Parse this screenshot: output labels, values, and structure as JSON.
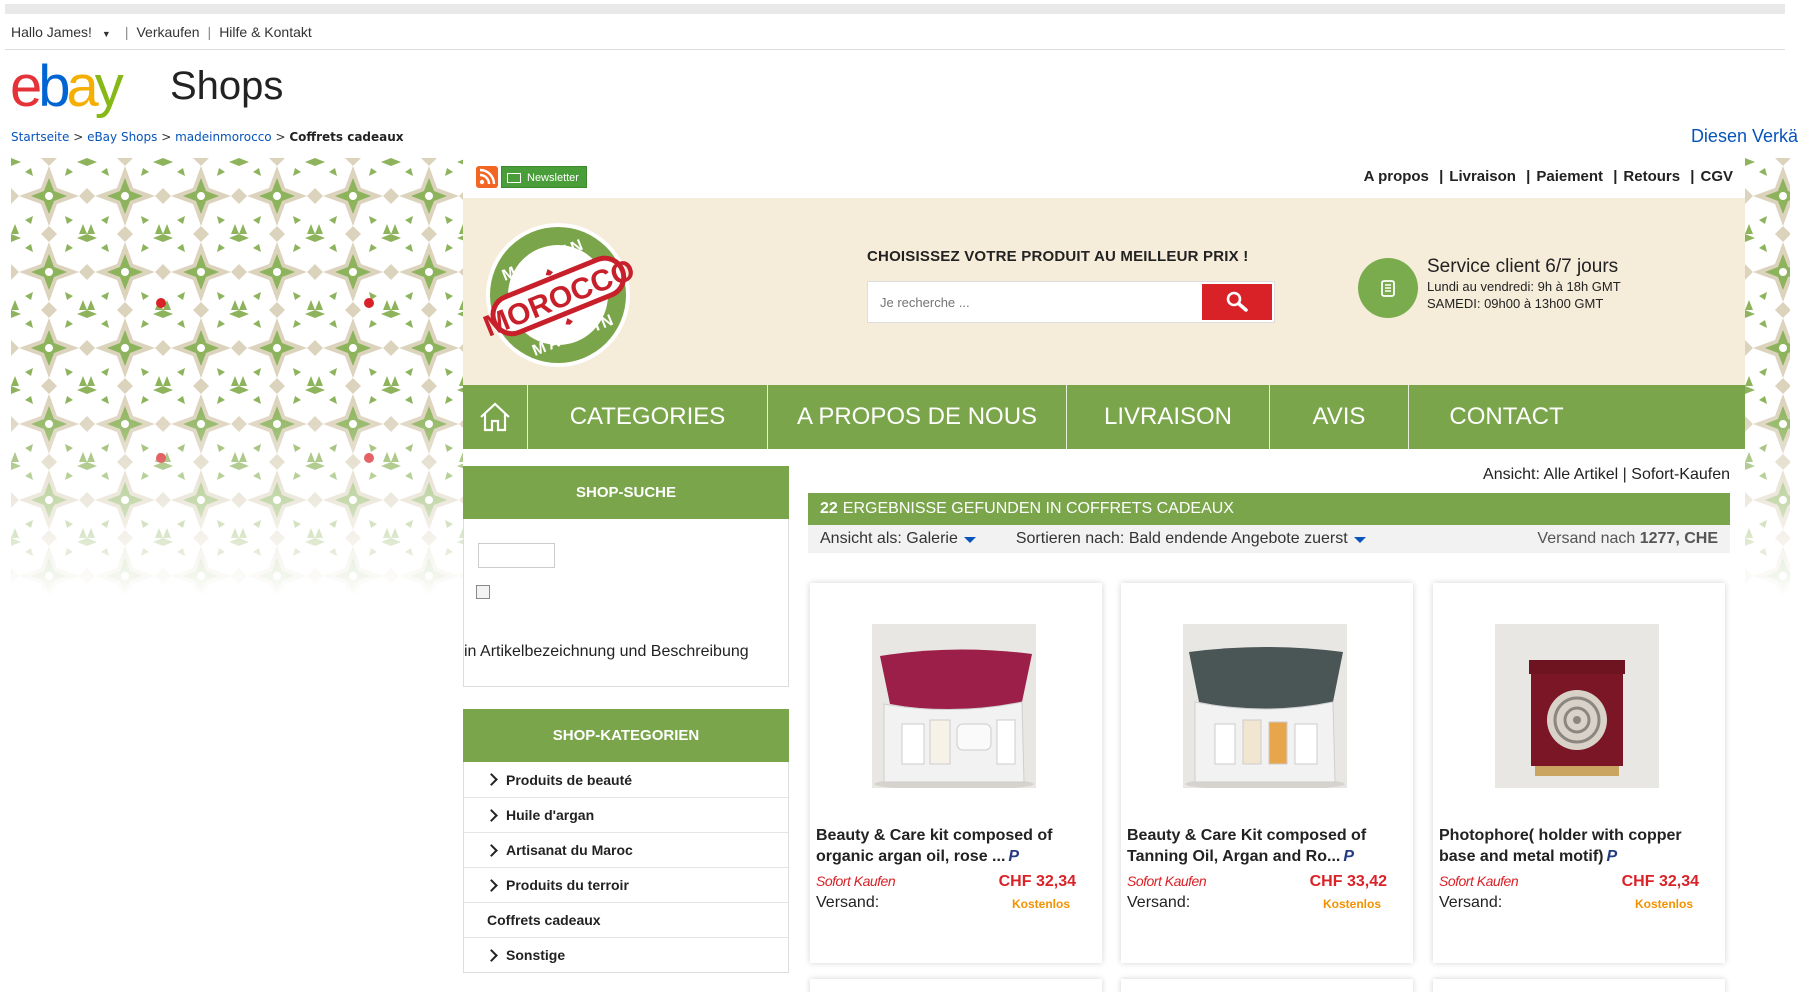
{
  "topbar": {
    "greeting": "Hallo James!",
    "sell": "Verkaufen",
    "help": "Hilfe & Kontakt"
  },
  "brand": {
    "logo_e": "e",
    "logo_b": "b",
    "logo_a": "a",
    "logo_y": "y",
    "section": "Shops",
    "colors": {
      "red": "#e53238",
      "blue": "#0064d2",
      "yellow": "#f5af02",
      "green": "#86b817"
    }
  },
  "breadcrumb": {
    "items": [
      "Startseite",
      "eBay Shops",
      "madeinmorocco"
    ],
    "current": "Coffrets cadeaux",
    "seller_link": "Diesen Verkä"
  },
  "store": {
    "newsletter": "Newsletter",
    "util_links": [
      "A propos",
      "Livraison",
      "Paiement",
      "Retours",
      "CGV"
    ],
    "logo_text_top": "MADE IN",
    "logo_text_main": "MOROCCO",
    "logo_text_bottom": "MADE IN",
    "tagline": "CHOISISSEZ VOTRE PRODUIT AU MEILLEUR PRIX !",
    "search_placeholder": "Je recherche ...",
    "service_title": "Service client 6/7 jours",
    "service_line1": "Lundi au vendredi: 9h à 18h GMT",
    "service_line2": "SAMEDI: 09h00 à 13h00 GMT",
    "accent": "#7aa54a",
    "header_bg": "#f6ecda"
  },
  "nav": {
    "items": [
      "CATEGORIES",
      "A PROPOS DE NOUS",
      "LIVRAISON",
      "AVIS",
      "CONTACT"
    ]
  },
  "sidebar": {
    "search_title": "SHOP-SUCHE",
    "search_scope_label": "in Artikelbezeichnung und Beschreibung",
    "categories_title": "SHOP-KATEGORIEN",
    "categories": [
      "Produits de beauté",
      "Huile d'argan",
      "Artisanat du Maroc",
      "Produits du terroir",
      "Coffrets cadeaux",
      "Sonstige"
    ]
  },
  "results": {
    "view_label": "Ansicht:",
    "view_all": "Alle Artikel",
    "view_buy_now": "Sofort-Kaufen",
    "count": "22",
    "found_text": "ERGEBNISSE GEFUNDEN IN COFFRETS CADEAUX",
    "view_as_label": "Ansicht als:",
    "view_as_value": "Galerie",
    "sort_label": "Sortieren nach:",
    "sort_value": "Bald endende Angebote zuerst",
    "ship_to_label": "Versand nach",
    "ship_to_value": "1277, CHE"
  },
  "products": [
    {
      "title": "Beauty & Care kit composed of organic argan oil, rose ...",
      "badge": "Sofort Kaufen",
      "price": "CHF 32,34",
      "shipping_label": "Versand:",
      "shipping": "Kostenlos"
    },
    {
      "title": "Beauty & Care Kit composed of Tanning Oil, Argan and Ro...",
      "badge": "Sofort Kaufen",
      "price": "CHF 33,42",
      "shipping_label": "Versand:",
      "shipping": "Kostenlos"
    },
    {
      "title": "Photophore( holder with copper base and metal motif)",
      "badge": "Sofort Kaufen",
      "price": "CHF 32,34",
      "shipping_label": "Versand:",
      "shipping": "Kostenlos"
    }
  ]
}
